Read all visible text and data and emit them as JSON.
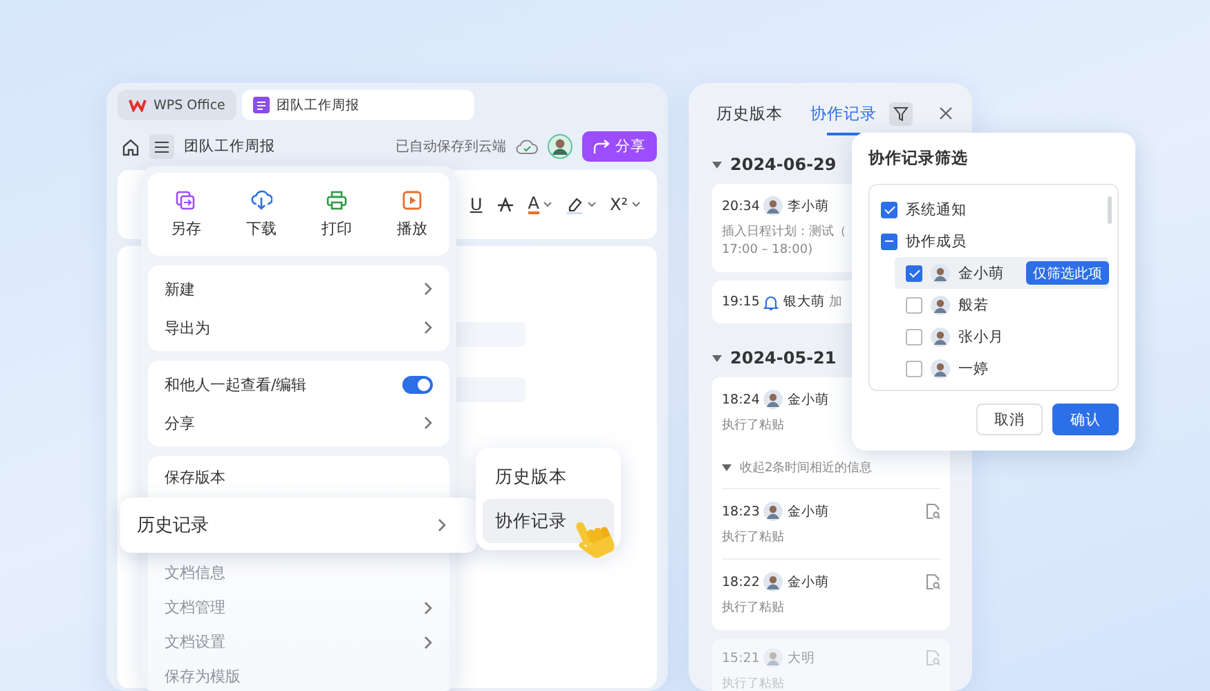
{
  "window": {
    "tabs": [
      {
        "label": "WPS Office",
        "kind": "home",
        "selected": false
      },
      {
        "label": "团队工作周报",
        "kind": "doc",
        "selected": true
      }
    ],
    "toolbar": {
      "doc_title": "团队工作周报",
      "save_status": "已自动保存到云端",
      "share_button": "分享"
    },
    "format_buttons": [
      {
        "kind": "underline",
        "glyph": "U"
      },
      {
        "kind": "strike"
      },
      {
        "kind": "font_color",
        "glyph": "A"
      },
      {
        "kind": "highlight"
      },
      {
        "kind": "superscript",
        "glyph": "X²"
      }
    ]
  },
  "menu": {
    "quick_actions": [
      {
        "label": "另存",
        "kind": "save_as"
      },
      {
        "label": "下载",
        "kind": "download"
      },
      {
        "label": "打印",
        "kind": "print"
      },
      {
        "label": "播放",
        "kind": "play"
      }
    ],
    "groups": [
      [
        {
          "label": "新建",
          "kind": "submenu"
        },
        {
          "label": "导出为",
          "kind": "submenu"
        }
      ],
      [
        {
          "label": "和他人一起查看/编辑",
          "kind": "toggle",
          "on": true
        },
        {
          "label": "分享",
          "kind": "submenu"
        }
      ],
      [
        {
          "label": "保存版本",
          "kind": "plain",
          "highlighted": false
        },
        {
          "label": "历史记录",
          "kind": "submenu",
          "highlighted": true
        },
        {
          "label": "文档信息",
          "kind": "plain",
          "highlighted": false
        },
        {
          "label": "文档管理",
          "kind": "submenu",
          "highlighted": false
        },
        {
          "label": "文档设置",
          "kind": "submenu",
          "highlighted": false
        },
        {
          "label": "保存为模版",
          "kind": "plain",
          "highlighted": false
        }
      ]
    ]
  },
  "submenu": [
    {
      "label": "历史版本",
      "selected": false
    },
    {
      "label": "协作记录",
      "selected": true
    }
  ],
  "history_panel": {
    "tabs": [
      {
        "label": "历史版本",
        "selected": false
      },
      {
        "label": "协作记录",
        "selected": true
      }
    ],
    "groups": [
      {
        "date": "2024-06-29",
        "expanded": true,
        "cards": [
          {
            "entries": [
              {
                "kind": "user",
                "time": "20:34",
                "user": "李小萌",
                "action": "插入日程计划：测试（ 17:00 – 18:00)"
              }
            ]
          },
          {
            "entries": [
              {
                "kind": "notice",
                "time": "19:15",
                "user": "银大萌",
                "action": "加"
              }
            ]
          }
        ]
      },
      {
        "date": "2024-05-21",
        "expanded": true,
        "cards": [
          {
            "entries": [
              {
                "kind": "user",
                "time": "18:24",
                "user": "金小萌",
                "action": "执行了粘贴"
              },
              {
                "kind": "collapse",
                "label": "收起2条时间相近的信息",
                "expanded": true
              },
              {
                "kind": "user",
                "time": "18:23",
                "user": "金小萌",
                "action": "执行了粘贴",
                "preview": true
              },
              {
                "kind": "user",
                "time": "18:22",
                "user": "金小萌",
                "action": "执行了粘贴",
                "preview": true
              }
            ]
          },
          {
            "entries": [
              {
                "kind": "user",
                "time": "15:21",
                "user": "大明",
                "action": "执行了粘贴",
                "preview": true
              }
            ]
          }
        ]
      }
    ]
  },
  "filter_popup": {
    "title": "协作记录筛选",
    "options": [
      {
        "label": "系统通知",
        "checked": true
      },
      {
        "label": "协作成员",
        "checked": false,
        "indeterminate": true,
        "children": [
          {
            "label": "金小萌",
            "checked": true,
            "highlighted": true,
            "only_button": "仅筛选此项"
          },
          {
            "label": "般若",
            "checked": false,
            "highlighted": false
          },
          {
            "label": "张小月",
            "checked": false,
            "highlighted": false
          },
          {
            "label": "一婷",
            "checked": false,
            "highlighted": false
          }
        ]
      }
    ],
    "buttons": [
      {
        "label": "取消",
        "kind": "secondary"
      },
      {
        "label": "确认",
        "kind": "primary"
      }
    ]
  }
}
